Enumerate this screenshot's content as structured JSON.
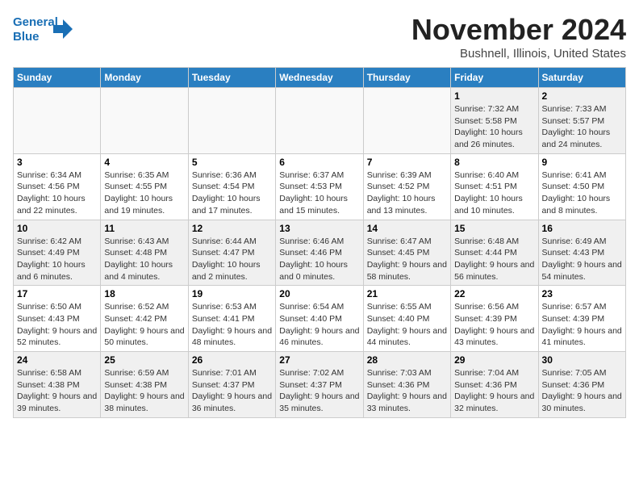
{
  "logo": {
    "line1": "General",
    "line2": "Blue"
  },
  "title": "November 2024",
  "location": "Bushnell, Illinois, United States",
  "weekdays": [
    "Sunday",
    "Monday",
    "Tuesday",
    "Wednesday",
    "Thursday",
    "Friday",
    "Saturday"
  ],
  "weeks": [
    [
      {
        "day": "",
        "empty": true
      },
      {
        "day": "",
        "empty": true
      },
      {
        "day": "",
        "empty": true
      },
      {
        "day": "",
        "empty": true
      },
      {
        "day": "",
        "empty": true
      },
      {
        "day": "1",
        "sunrise": "Sunrise: 7:32 AM",
        "sunset": "Sunset: 5:58 PM",
        "daylight": "Daylight: 10 hours and 26 minutes."
      },
      {
        "day": "2",
        "sunrise": "Sunrise: 7:33 AM",
        "sunset": "Sunset: 5:57 PM",
        "daylight": "Daylight: 10 hours and 24 minutes."
      }
    ],
    [
      {
        "day": "3",
        "sunrise": "Sunrise: 6:34 AM",
        "sunset": "Sunset: 4:56 PM",
        "daylight": "Daylight: 10 hours and 22 minutes."
      },
      {
        "day": "4",
        "sunrise": "Sunrise: 6:35 AM",
        "sunset": "Sunset: 4:55 PM",
        "daylight": "Daylight: 10 hours and 19 minutes."
      },
      {
        "day": "5",
        "sunrise": "Sunrise: 6:36 AM",
        "sunset": "Sunset: 4:54 PM",
        "daylight": "Daylight: 10 hours and 17 minutes."
      },
      {
        "day": "6",
        "sunrise": "Sunrise: 6:37 AM",
        "sunset": "Sunset: 4:53 PM",
        "daylight": "Daylight: 10 hours and 15 minutes."
      },
      {
        "day": "7",
        "sunrise": "Sunrise: 6:39 AM",
        "sunset": "Sunset: 4:52 PM",
        "daylight": "Daylight: 10 hours and 13 minutes."
      },
      {
        "day": "8",
        "sunrise": "Sunrise: 6:40 AM",
        "sunset": "Sunset: 4:51 PM",
        "daylight": "Daylight: 10 hours and 10 minutes."
      },
      {
        "day": "9",
        "sunrise": "Sunrise: 6:41 AM",
        "sunset": "Sunset: 4:50 PM",
        "daylight": "Daylight: 10 hours and 8 minutes."
      }
    ],
    [
      {
        "day": "10",
        "sunrise": "Sunrise: 6:42 AM",
        "sunset": "Sunset: 4:49 PM",
        "daylight": "Daylight: 10 hours and 6 minutes."
      },
      {
        "day": "11",
        "sunrise": "Sunrise: 6:43 AM",
        "sunset": "Sunset: 4:48 PM",
        "daylight": "Daylight: 10 hours and 4 minutes."
      },
      {
        "day": "12",
        "sunrise": "Sunrise: 6:44 AM",
        "sunset": "Sunset: 4:47 PM",
        "daylight": "Daylight: 10 hours and 2 minutes."
      },
      {
        "day": "13",
        "sunrise": "Sunrise: 6:46 AM",
        "sunset": "Sunset: 4:46 PM",
        "daylight": "Daylight: 10 hours and 0 minutes."
      },
      {
        "day": "14",
        "sunrise": "Sunrise: 6:47 AM",
        "sunset": "Sunset: 4:45 PM",
        "daylight": "Daylight: 9 hours and 58 minutes."
      },
      {
        "day": "15",
        "sunrise": "Sunrise: 6:48 AM",
        "sunset": "Sunset: 4:44 PM",
        "daylight": "Daylight: 9 hours and 56 minutes."
      },
      {
        "day": "16",
        "sunrise": "Sunrise: 6:49 AM",
        "sunset": "Sunset: 4:43 PM",
        "daylight": "Daylight: 9 hours and 54 minutes."
      }
    ],
    [
      {
        "day": "17",
        "sunrise": "Sunrise: 6:50 AM",
        "sunset": "Sunset: 4:43 PM",
        "daylight": "Daylight: 9 hours and 52 minutes."
      },
      {
        "day": "18",
        "sunrise": "Sunrise: 6:52 AM",
        "sunset": "Sunset: 4:42 PM",
        "daylight": "Daylight: 9 hours and 50 minutes."
      },
      {
        "day": "19",
        "sunrise": "Sunrise: 6:53 AM",
        "sunset": "Sunset: 4:41 PM",
        "daylight": "Daylight: 9 hours and 48 minutes."
      },
      {
        "day": "20",
        "sunrise": "Sunrise: 6:54 AM",
        "sunset": "Sunset: 4:40 PM",
        "daylight": "Daylight: 9 hours and 46 minutes."
      },
      {
        "day": "21",
        "sunrise": "Sunrise: 6:55 AM",
        "sunset": "Sunset: 4:40 PM",
        "daylight": "Daylight: 9 hours and 44 minutes."
      },
      {
        "day": "22",
        "sunrise": "Sunrise: 6:56 AM",
        "sunset": "Sunset: 4:39 PM",
        "daylight": "Daylight: 9 hours and 43 minutes."
      },
      {
        "day": "23",
        "sunrise": "Sunrise: 6:57 AM",
        "sunset": "Sunset: 4:39 PM",
        "daylight": "Daylight: 9 hours and 41 minutes."
      }
    ],
    [
      {
        "day": "24",
        "sunrise": "Sunrise: 6:58 AM",
        "sunset": "Sunset: 4:38 PM",
        "daylight": "Daylight: 9 hours and 39 minutes."
      },
      {
        "day": "25",
        "sunrise": "Sunrise: 6:59 AM",
        "sunset": "Sunset: 4:38 PM",
        "daylight": "Daylight: 9 hours and 38 minutes."
      },
      {
        "day": "26",
        "sunrise": "Sunrise: 7:01 AM",
        "sunset": "Sunset: 4:37 PM",
        "daylight": "Daylight: 9 hours and 36 minutes."
      },
      {
        "day": "27",
        "sunrise": "Sunrise: 7:02 AM",
        "sunset": "Sunset: 4:37 PM",
        "daylight": "Daylight: 9 hours and 35 minutes."
      },
      {
        "day": "28",
        "sunrise": "Sunrise: 7:03 AM",
        "sunset": "Sunset: 4:36 PM",
        "daylight": "Daylight: 9 hours and 33 minutes."
      },
      {
        "day": "29",
        "sunrise": "Sunrise: 7:04 AM",
        "sunset": "Sunset: 4:36 PM",
        "daylight": "Daylight: 9 hours and 32 minutes."
      },
      {
        "day": "30",
        "sunrise": "Sunrise: 7:05 AM",
        "sunset": "Sunset: 4:36 PM",
        "daylight": "Daylight: 9 hours and 30 minutes."
      }
    ]
  ]
}
